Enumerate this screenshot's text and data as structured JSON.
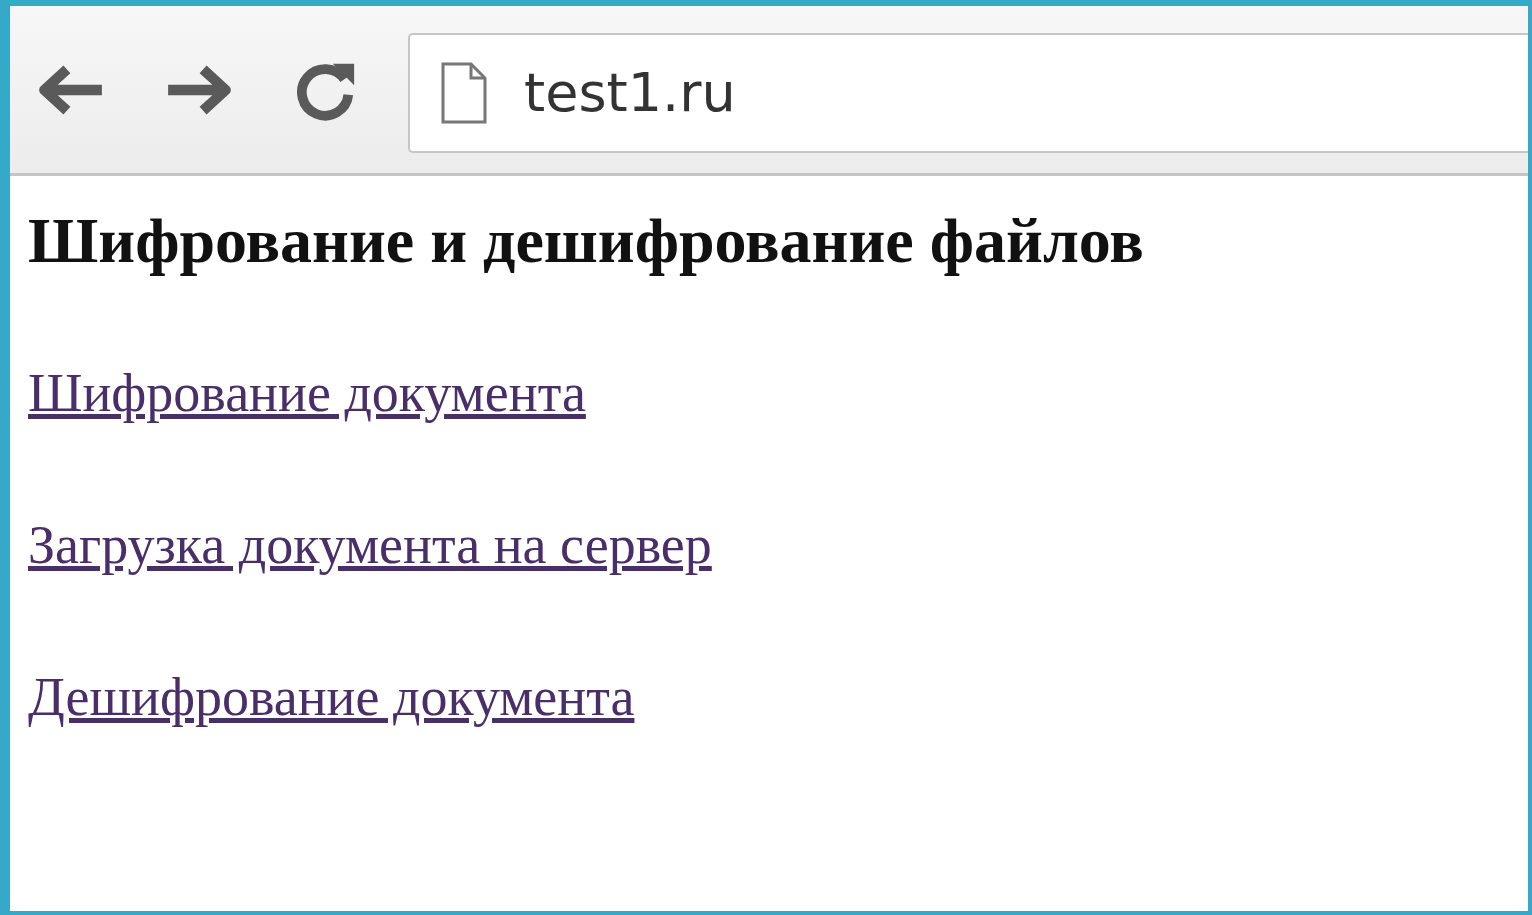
{
  "browser": {
    "address": "test1.ru"
  },
  "page": {
    "heading": "Шифрование и дешифрование файлов",
    "links": [
      {
        "label": "Шифрование документа"
      },
      {
        "label": "Загрузка документа на сервер"
      },
      {
        "label": "Дешифрование документа"
      }
    ]
  }
}
